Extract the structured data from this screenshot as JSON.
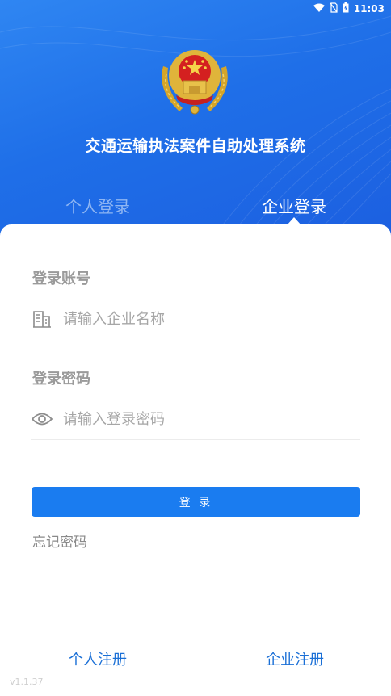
{
  "status_bar": {
    "time": "11:03"
  },
  "app": {
    "title": "交通运输执法案件自助处理系统"
  },
  "tabs": {
    "personal": "个人登录",
    "enterprise": "企业登录",
    "active": "enterprise"
  },
  "form": {
    "account_label": "登录账号",
    "account_placeholder": "请输入企业名称",
    "password_label": "登录密码",
    "password_placeholder": "请输入登录密码",
    "login_button": "登 录",
    "forgot_password": "忘记密码"
  },
  "footer": {
    "register_personal": "个人注册",
    "register_enterprise": "企业注册",
    "version": "v1.1.37"
  },
  "colors": {
    "header_blue": "#1f6fe8",
    "button_blue": "#1a7cf0",
    "link_blue": "#1a6fd6"
  },
  "icons": [
    "wifi-icon",
    "no-sim-icon",
    "battery-icon",
    "building-icon",
    "eye-icon",
    "police-emblem"
  ]
}
